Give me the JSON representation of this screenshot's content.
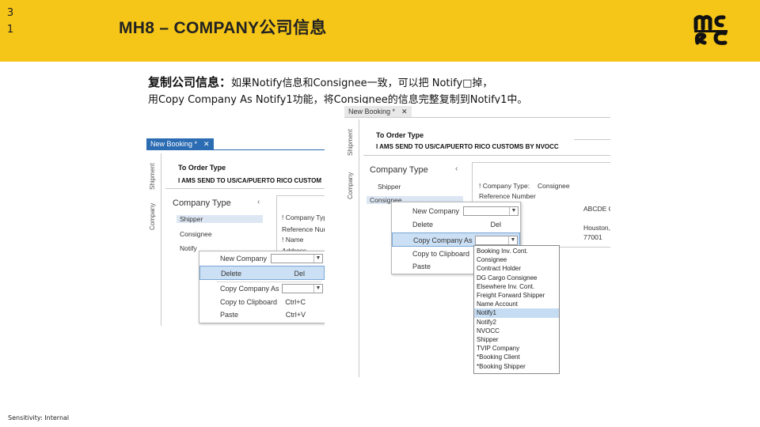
{
  "slide": {
    "page_number_line1": "3",
    "page_number_line2": "1",
    "title": "MH8 – COMPANY公司信息",
    "instruction_bold": "复制公司信息：",
    "instruction_line1_rest": "如果Notify信息和Consignee一致，可以把 Notify□掉，",
    "instruction_line2": "用Copy Company As Notify1功能，将Consignee的信息完整复制到Notify1中。",
    "footer": "Sensitivity: Internal",
    "colors": {
      "header_bg": "#f5c518",
      "tab_blue": "#2b6cb3",
      "highlight": "#cce0f5"
    }
  },
  "left_shot": {
    "tab_label": "New Booking *",
    "tab_close": "✕",
    "vtab_shipment": "Shipment",
    "vtab_company": "Company",
    "header_line1": "To Order Type",
    "header_line2": "I AMS SEND TO US/CA/PUERTO RICO CUSTOM",
    "company_type_title": "Company Type",
    "chevron": "‹",
    "list": [
      "Shipper",
      "Consignee",
      "Notify"
    ],
    "right_rows": [
      "! Company Typ",
      "Reference Num",
      "! Name",
      "Address"
    ],
    "context_menu": [
      {
        "label": "New Company",
        "shortcut": ""
      },
      {
        "label": "Delete",
        "shortcut": "Del"
      },
      {
        "label": "Copy Company As",
        "shortcut": ""
      },
      {
        "label": "Copy to Clipboard",
        "shortcut": "Ctrl+C"
      },
      {
        "label": "Paste",
        "shortcut": "Ctrl+V"
      }
    ]
  },
  "right_shot": {
    "tab_label": "New Booking *",
    "tab_close": "✕",
    "vtab_shipment": "Shipment",
    "vtab_company": "Company",
    "header_line1": "To Order Type",
    "header_line2": "I AMS SEND TO US/CA/PUERTO RICO CUSTOMS BY NVOCC",
    "company_type_title": "Company Type",
    "chevron": "‹",
    "list": [
      "Shipper",
      "Consignee"
    ],
    "right_rows": [
      {
        "label": "! Company Type:",
        "value": "Consignee"
      },
      {
        "label": "Reference Number",
        "value": ""
      },
      {
        "label": "",
        "value": "ABCDE COMPANY"
      },
      {
        "label": "",
        "value": "Houston, TX"
      },
      {
        "label": "",
        "value": "77001"
      }
    ],
    "context_menu": [
      {
        "label": "New Company",
        "shortcut": ""
      },
      {
        "label": "Delete",
        "shortcut": "Del"
      },
      {
        "label": "Copy Company As",
        "shortcut": ""
      },
      {
        "label": "Copy to Clipboard",
        "shortcut": ""
      },
      {
        "label": "Paste",
        "shortcut": ""
      }
    ],
    "dropdown_options": [
      "Booking Inv. Cont.",
      "Consignee",
      "Contract Holder",
      "DG Cargo Consignee",
      "Elsewhere Inv. Cont.",
      "Freight Forward Shipper",
      "Name Account",
      "Notify1",
      "Notify2",
      "NVOCC",
      "Shipper",
      "TVIP Company",
      "*Booking Client",
      "*Booking Shipper"
    ],
    "dropdown_selected": "Notify1"
  }
}
